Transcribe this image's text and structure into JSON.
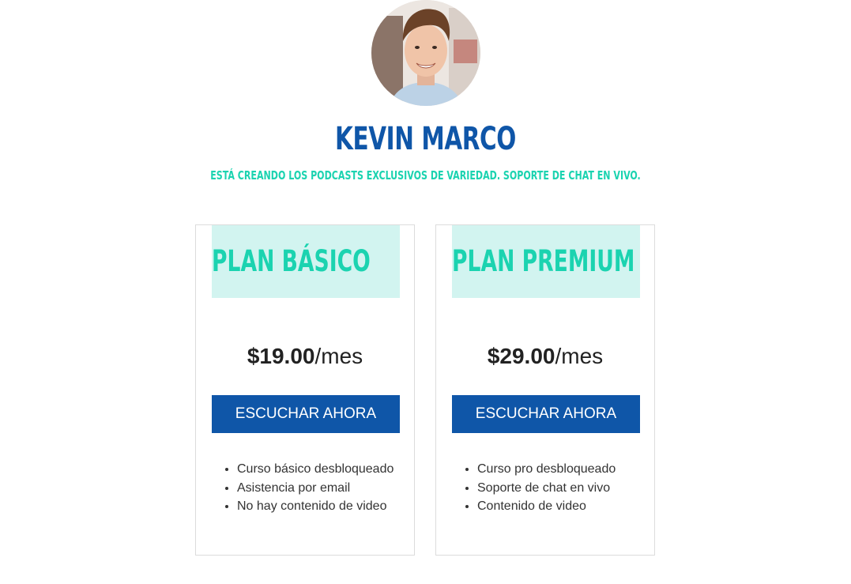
{
  "profile": {
    "name": "KEVIN MARCO",
    "tagline": "ESTÁ CREANDO LOS PODCASTS EXCLUSIVOS DE VARIEDAD. SOPORTE DE CHAT EN VIVO."
  },
  "plans": [
    {
      "title": "PLAN BÁSICO",
      "price": "$19.00",
      "period": "/mes",
      "button_label": "ESCUCHAR AHORA",
      "features": [
        "Curso básico desbloqueado",
        "Asistencia por email",
        "No hay contenido de video"
      ]
    },
    {
      "title": "PLAN PREMIUM",
      "price": "$29.00",
      "period": "/mes",
      "button_label": "ESCUCHAR AHORA",
      "features": [
        "Curso pro desbloqueado",
        "Soporte de chat en vivo",
        "Contenido de video"
      ]
    }
  ],
  "colors": {
    "brand_blue": "#0f56a8",
    "accent_teal": "#1bd3b0",
    "header_tint": "#d2f4f0"
  }
}
